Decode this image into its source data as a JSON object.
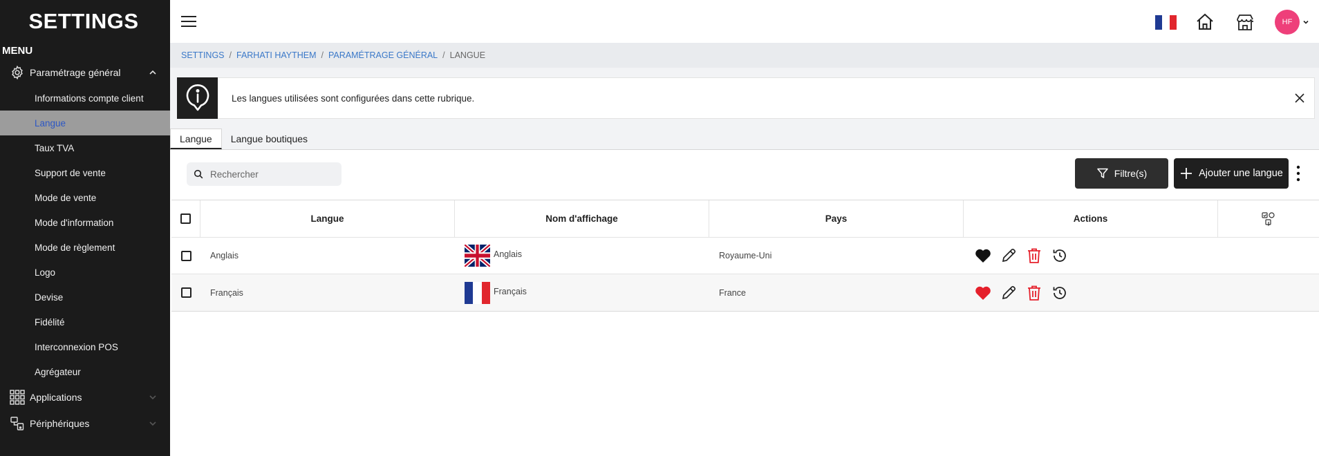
{
  "app": {
    "title": "SETTINGS",
    "menu_label": "MENU"
  },
  "sidebar": {
    "group_general": {
      "label": "Paramétrage général"
    },
    "items": [
      {
        "label": "Informations compte client"
      },
      {
        "label": "Langue"
      },
      {
        "label": "Taux TVA"
      },
      {
        "label": "Support de vente"
      },
      {
        "label": "Mode de vente"
      },
      {
        "label": "Mode d'information"
      },
      {
        "label": "Mode de règlement"
      },
      {
        "label": "Logo"
      },
      {
        "label": "Devise"
      },
      {
        "label": "Fidélité"
      },
      {
        "label": "Interconnexion POS"
      },
      {
        "label": "Agrégateur"
      }
    ],
    "group_apps": {
      "label": "Applications"
    },
    "group_devices": {
      "label": "Périphériques"
    }
  },
  "header": {
    "avatar_initials": "HF"
  },
  "breadcrumb": [
    "SETTINGS",
    "FARHATI HAYTHEM",
    "PARAMÉTRAGE GÉNÉRAL",
    "LANGUE"
  ],
  "banner": {
    "text": "Les langues utilisées sont configurées dans cette rubrique."
  },
  "tabs": [
    {
      "label": "Langue"
    },
    {
      "label": "Langue boutiques"
    }
  ],
  "toolbar": {
    "search_placeholder": "Rechercher",
    "filter_label": "Filtre(s)",
    "add_label": "Ajouter une langue"
  },
  "table": {
    "columns": [
      "Langue",
      "Nom d'affichage",
      "Pays",
      "Actions"
    ],
    "rows": [
      {
        "langue": "Anglais",
        "display_name": "Anglais",
        "flag": "uk-flag",
        "pays": "Royaume-Uni",
        "favorite": false
      },
      {
        "langue": "Français",
        "display_name": "Français",
        "flag": "fr-flag",
        "pays": "France",
        "favorite": true
      }
    ]
  },
  "colors": {
    "sidebar_bg": "#1b1b1b",
    "active_item_bg": "#9c9c9c",
    "active_item_text": "#2c57c4",
    "link": "#3a78c8",
    "avatar": "#ee3f7a",
    "danger": "#e5202b"
  }
}
